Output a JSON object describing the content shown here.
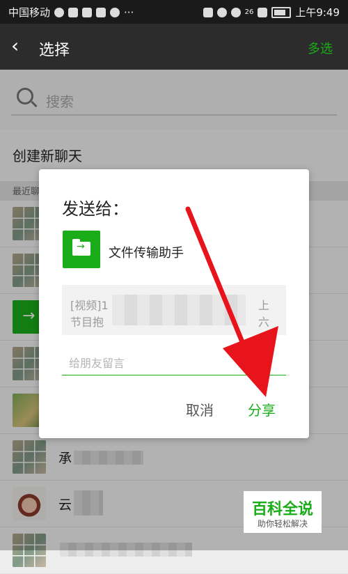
{
  "statusbar": {
    "carrier": "中国移动",
    "network": "26",
    "time": "上午9:49"
  },
  "titlebar": {
    "back_label": "‹",
    "title": "选择",
    "multi_select": "多选"
  },
  "search": {
    "placeholder": "搜索"
  },
  "new_chat": "创建新聊天",
  "section_recent": "最近聊天",
  "chat_list": {
    "rows": [
      {
        "avatar": "group-avatar",
        "name": ""
      },
      {
        "avatar": "group-avatar",
        "name": ""
      },
      {
        "avatar": "file-transfer-avatar",
        "name": ""
      },
      {
        "avatar": "group-avatar",
        "name": ""
      },
      {
        "avatar": "photo-avatar",
        "name": ""
      },
      {
        "avatar": "group-avatar",
        "name": "承"
      },
      {
        "avatar": "cartoon-avatar",
        "name": "云"
      },
      {
        "avatar": "group-avatar",
        "name": ""
      }
    ]
  },
  "dialog": {
    "title": "发送给：",
    "contact_name": "文件传输助手",
    "preview_line1_start": "[视频]1",
    "preview_line1_end": "上",
    "preview_line2_start": "节目抱",
    "preview_line2_end": "六",
    "message_placeholder": "给朋友留言",
    "cancel_label": "取消",
    "share_label": "分享"
  },
  "watermark": {
    "main": "百科全说",
    "sub": "助你轻松解决"
  },
  "colors": {
    "accent": "#1aad19",
    "annotation_arrow": "#e8141b"
  }
}
